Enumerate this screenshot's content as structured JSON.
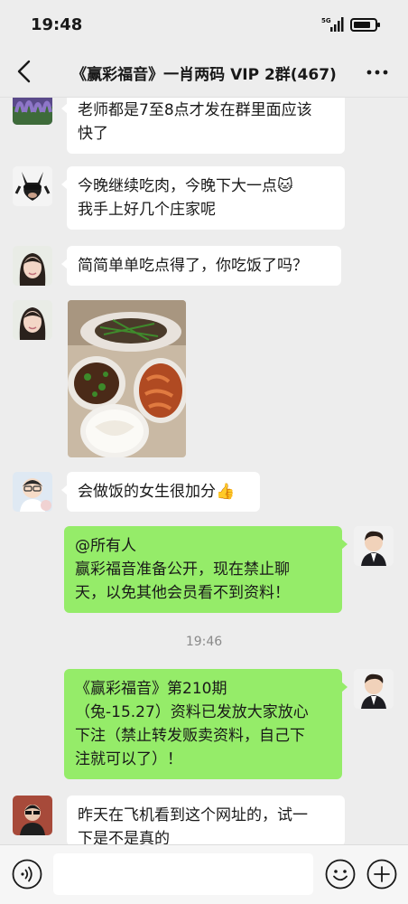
{
  "status_bar": {
    "time": "19:48",
    "network": "5G"
  },
  "header": {
    "title": "《赢彩福音》一肖两码 VIP 2群(467)"
  },
  "messages": [
    {
      "sender": "lavender-avatar",
      "direction": "in",
      "lines": [
        "老师都是7至8点才发在群里面应该",
        "快了"
      ]
    },
    {
      "sender": "bulldog-avatar",
      "direction": "in",
      "lines": [
        "今晚继续吃肉，今晚下大一点🐱",
        "我手上好几个庄家呢"
      ]
    },
    {
      "sender": "girl-avatar",
      "direction": "in",
      "lines": [
        "简简单单吃点得了，你吃饭了吗？"
      ]
    },
    {
      "sender": "girl-avatar",
      "direction": "in",
      "type": "image",
      "image_desc": "food-photo"
    },
    {
      "sender": "cartoon-avatar",
      "direction": "in",
      "lines": [
        "会做饭的女生很加分👍"
      ]
    },
    {
      "sender": "self",
      "direction": "out",
      "lines": [
        "@所有人",
        "赢彩福音准备公开，现在禁止聊",
        "天，以免其他会员看不到资料！"
      ]
    },
    {
      "type": "timestamp",
      "text": "19:46"
    },
    {
      "sender": "self",
      "direction": "out",
      "lines": [
        "《赢彩福音》第210期",
        "（兔-15.27）资料已发放大家放心",
        "下注（禁止转发贩卖资料，自己下",
        "注就可以了）！"
      ]
    },
    {
      "sender": "man-avatar",
      "direction": "in",
      "lines": [
        "昨天在飞机看到这个网址的，试一",
        "下是不是真的"
      ]
    }
  ],
  "input": {
    "placeholder": ""
  },
  "colors": {
    "bubble_out": "#95ec69",
    "bubble_in": "#ffffff",
    "background": "#ededed"
  }
}
